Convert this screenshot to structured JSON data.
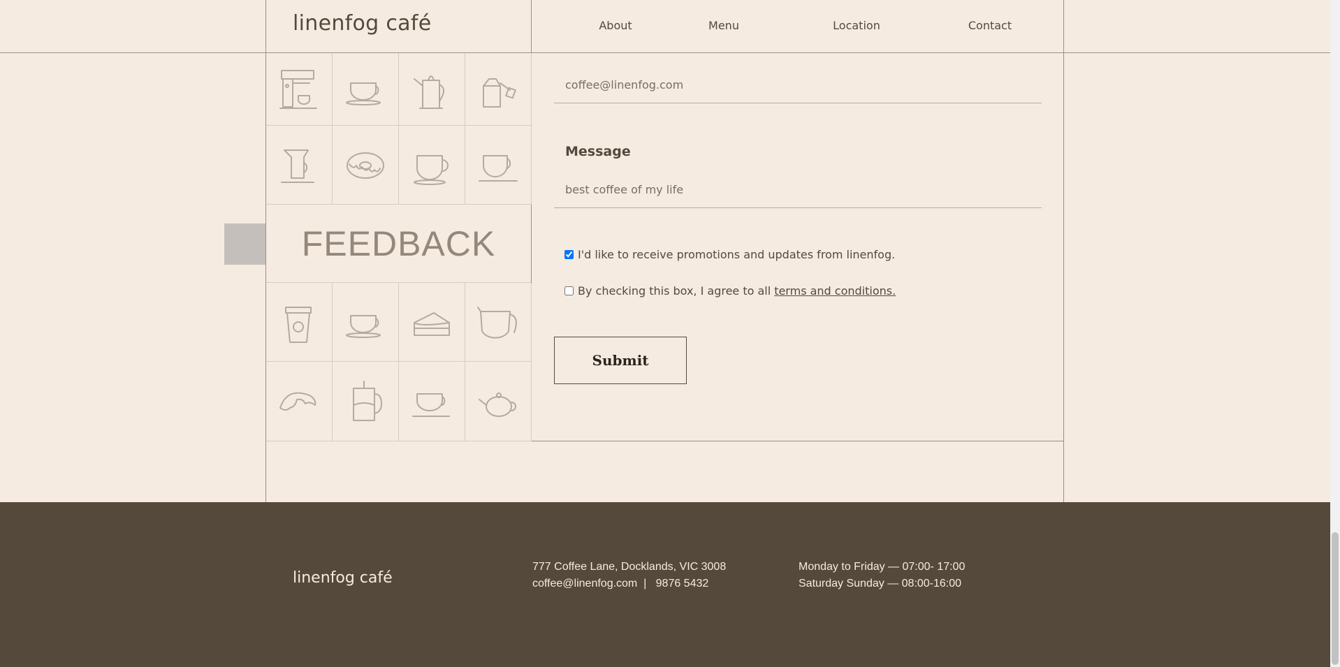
{
  "header": {
    "brand": "linenfog café",
    "nav": [
      {
        "label": "About"
      },
      {
        "label": "Menu"
      },
      {
        "label": "Location"
      },
      {
        "label": "Contact"
      }
    ]
  },
  "feedback": {
    "title": "FEEDBACK",
    "tiles_top": [
      "espresso-machine-icon",
      "coffee-cup-icon",
      "pour-over-kettle-icon",
      "tea-bag-icon",
      "pour-over-dripper-icon",
      "donut-icon",
      "mug-icon",
      "teacup-icon"
    ],
    "tiles_bottom": [
      "takeaway-cup-icon",
      "coffee-cup-icon",
      "cake-slice-icon",
      "coffee-pot-icon",
      "croissant-icon",
      "french-press-icon",
      "cup-saucer-icon",
      "teapot-icon"
    ]
  },
  "form": {
    "email_value": "coffee@linenfog.com",
    "message_label": "Message",
    "message_value": "best coffee of my life",
    "promo_label": "I'd like to receive promotions and updates from linenfog.",
    "promo_checked": true,
    "terms_prefix": "By checking this box, I agree to all",
    "terms_link": "terms and conditions.",
    "terms_checked": false,
    "submit_label": "Submit"
  },
  "footer": {
    "brand": "linenfog café",
    "address": "777 Coffee Lane, Docklands, VIC 3008",
    "contact": "coffee@linenfog.com  |   9876 5432",
    "hours_weekday": "Monday to Friday — 07:00- 17:00",
    "hours_weekend": "Saturday Sunday — 08:00-16:00"
  },
  "colors": {
    "background": "#f5ebe1",
    "text": "#54493a",
    "footer_bg": "#54493a",
    "line": "#9a9089"
  }
}
